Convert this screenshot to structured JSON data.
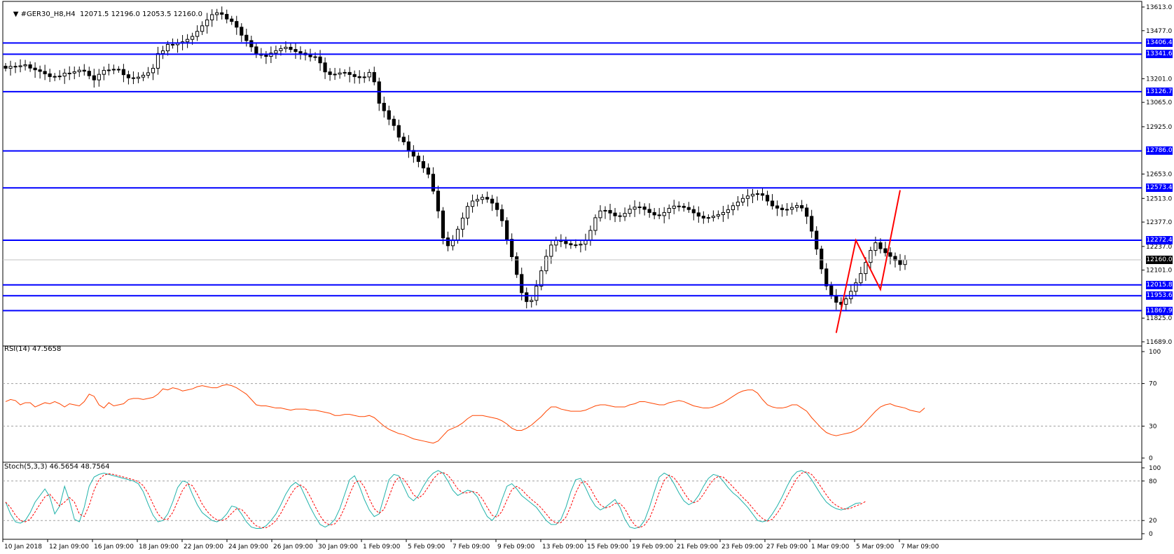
{
  "header": {
    "symbol_label": "#GER30_H8,H4",
    "ohlc_label": "12071.5 12196.0 12053.5 12160.0"
  },
  "colors": {
    "background": "#ffffff",
    "levels": "#0000ff",
    "zigzag": "#ff0000",
    "rsi": "#ff4500",
    "stoch_main": "#20b2aa",
    "stoch_signal": "#ff0000",
    "bull_candle": "#ffffff",
    "bear_candle": "#000000",
    "current_price_tag": "#000000"
  },
  "chart_data": [
    {
      "type": "candlestick",
      "title": "#GER30_H8,H4",
      "ohlc_text": "12071.5 12196.0 12053.5 12160.0",
      "last": {
        "open": 12071.5,
        "high": 12196.0,
        "low": 12053.5,
        "close": 12160.0
      },
      "current_price_label": "12160.0",
      "y_axis_ticks": [
        "13613.0",
        "13477.0",
        "13201.0",
        "13065.0",
        "12925.0",
        "12653.0",
        "12513.0",
        "12377.0",
        "12237.0",
        "12101.0",
        "11825.0",
        "11689.0"
      ],
      "ylim": [
        11689,
        13613
      ],
      "x_axis_ticks": [
        "10 Jan 2018",
        "12 Jan 09:00",
        "16 Jan 09:00",
        "18 Jan 09:00",
        "22 Jan 09:00",
        "24 Jan 09:00",
        "26 Jan 09:00",
        "30 Jan 09:00",
        "1 Feb 09:00",
        "5 Feb 09:00",
        "7 Feb 09:00",
        "9 Feb 09:00",
        "13 Feb 09:00",
        "15 Feb 09:00",
        "19 Feb 09:00",
        "21 Feb 09:00",
        "23 Feb 09:00",
        "27 Feb 09:00",
        "1 Mar 09:00",
        "5 Mar 09:00",
        "7 Mar 09:00"
      ],
      "horizontal_levels": [
        {
          "label": "13406.4",
          "value": 13406.4
        },
        {
          "label": "13341.6",
          "value": 13341.6
        },
        {
          "label": "13126.7",
          "value": 13126.7
        },
        {
          "label": "12786.0",
          "value": 12786.0
        },
        {
          "label": "12573.4",
          "value": 12573.4
        },
        {
          "label": "12272.4",
          "value": 12272.4
        },
        {
          "label": "12015.8",
          "value": 12015.8
        },
        {
          "label": "11953.6",
          "value": 11953.6
        },
        {
          "label": "11867.9",
          "value": 11867.9
        }
      ],
      "closes": [
        13261,
        13272,
        13270,
        13275,
        13281,
        13262,
        13252,
        13243,
        13229,
        13213,
        13214,
        13216,
        13233,
        13233,
        13241,
        13250,
        13244,
        13218,
        13194,
        13226,
        13249,
        13251,
        13255,
        13254,
        13224,
        13206,
        13203,
        13210,
        13221,
        13235,
        13261,
        13346,
        13361,
        13398,
        13396,
        13405,
        13413,
        13427,
        13444,
        13473,
        13505,
        13539,
        13569,
        13580,
        13571,
        13544,
        13530,
        13497,
        13451,
        13420,
        13384,
        13344,
        13336,
        13329,
        13348,
        13362,
        13374,
        13382,
        13369,
        13357,
        13348,
        13338,
        13327,
        13326,
        13292,
        13240,
        13225,
        13227,
        13234,
        13237,
        13225,
        13213,
        13207,
        13211,
        13237,
        13183,
        13060,
        13017,
        12968,
        12932,
        12865,
        12838,
        12789,
        12756,
        12725,
        12688,
        12652,
        12555,
        12441,
        12286,
        12241,
        12275,
        12336,
        12400,
        12467,
        12498,
        12507,
        12519,
        12509,
        12486,
        12449,
        12385,
        12278,
        12178,
        12076,
        11971,
        11920,
        11927,
        12009,
        12097,
        12180,
        12245,
        12271,
        12266,
        12253,
        12246,
        12245,
        12250,
        12273,
        12329,
        12402,
        12441,
        12444,
        12429,
        12413,
        12409,
        12427,
        12451,
        12463,
        12464,
        12450,
        12432,
        12418,
        12414,
        12432,
        12456,
        12469,
        12468,
        12461,
        12449,
        12430,
        12411,
        12400,
        12403,
        12411,
        12420,
        12432,
        12448,
        12471,
        12492,
        12513,
        12527,
        12537,
        12540,
        12531,
        12498,
        12470,
        12457,
        12448,
        12450,
        12461,
        12472,
        12458,
        12410,
        12325,
        12222,
        12108,
        12010,
        11954,
        11916,
        11904,
        11936,
        11979,
        12028,
        12081,
        12145,
        12214,
        12258,
        12224,
        12201,
        12180,
        12157,
        12133,
        12160
      ],
      "zigzag": [
        {
          "bar": 169,
          "price": 11740
        },
        {
          "bar": 173,
          "price": 12272
        },
        {
          "bar": 178,
          "price": 11990
        },
        {
          "bar": 182,
          "price": 12560
        }
      ]
    },
    {
      "type": "line",
      "title": "RSI(14) 47.5658",
      "series": [
        {
          "name": "RSI(14)",
          "values": [
            53,
            55,
            54,
            50,
            52,
            52,
            48,
            50,
            52,
            51,
            53,
            51,
            48,
            51,
            50,
            49,
            53,
            60,
            58,
            50,
            47,
            52,
            49,
            50,
            51,
            55,
            56,
            56,
            55,
            56,
            57,
            60,
            65,
            64,
            66,
            65,
            63,
            64,
            65,
            67,
            68,
            67,
            66,
            66,
            68,
            69,
            68,
            66,
            63,
            60,
            55,
            50,
            49,
            49,
            48,
            47,
            47,
            46,
            45,
            46,
            46,
            46,
            45,
            45,
            44,
            43,
            42,
            40,
            40,
            41,
            41,
            40,
            39,
            39,
            40,
            38,
            34,
            30,
            27,
            25,
            23,
            22,
            20,
            18,
            17,
            16,
            15,
            14,
            16,
            21,
            26,
            28,
            30,
            33,
            37,
            40,
            40,
            40,
            39,
            38,
            37,
            35,
            32,
            28,
            26,
            26,
            28,
            31,
            35,
            39,
            44,
            48,
            48,
            46,
            45,
            44,
            44,
            44,
            45,
            47,
            49,
            50,
            50,
            49,
            48,
            48,
            48,
            50,
            51,
            53,
            53,
            52,
            51,
            50,
            50,
            52,
            53,
            54,
            53,
            51,
            49,
            48,
            47,
            47,
            48,
            50,
            52,
            55,
            58,
            61,
            63,
            64,
            64,
            61,
            55,
            50,
            48,
            47,
            47,
            48,
            50,
            50,
            47,
            44,
            38,
            33,
            28,
            24,
            22,
            21,
            22,
            23,
            24,
            26,
            29,
            34,
            39,
            44,
            48,
            50,
            51,
            49,
            48,
            47,
            45,
            44,
            43,
            47
          ]
        }
      ],
      "ylim": [
        0,
        100
      ],
      "y_axis_ticks": [
        "100",
        "70",
        "30",
        "0"
      ],
      "levels": [
        70,
        30
      ]
    },
    {
      "type": "line",
      "title": "Stoch(5,3,3) 46.5654 48.7564",
      "series": [
        {
          "name": "main",
          "values": [
            48,
            30,
            18,
            16,
            20,
            32,
            48,
            58,
            68,
            56,
            30,
            42,
            72,
            50,
            22,
            18,
            40,
            72,
            86,
            90,
            92,
            90,
            88,
            86,
            84,
            82,
            80,
            76,
            64,
            45,
            28,
            18,
            20,
            30,
            48,
            70,
            80,
            78,
            60,
            44,
            32,
            26,
            20,
            18,
            22,
            30,
            42,
            40,
            30,
            18,
            10,
            8,
            8,
            12,
            20,
            30,
            44,
            60,
            72,
            78,
            72,
            56,
            40,
            26,
            14,
            10,
            14,
            22,
            38,
            60,
            82,
            88,
            72,
            52,
            36,
            26,
            30,
            56,
            82,
            90,
            88,
            72,
            56,
            50,
            58,
            72,
            84,
            92,
            96,
            92,
            80,
            66,
            58,
            62,
            66,
            64,
            56,
            40,
            26,
            20,
            30,
            52,
            72,
            76,
            68,
            58,
            52,
            46,
            40,
            30,
            20,
            14,
            14,
            22,
            40,
            64,
            82,
            84,
            70,
            54,
            42,
            36,
            40,
            46,
            52,
            40,
            22,
            10,
            8,
            10,
            20,
            40,
            64,
            86,
            92,
            88,
            76,
            62,
            50,
            44,
            48,
            58,
            72,
            84,
            90,
            88,
            80,
            70,
            62,
            56,
            48,
            40,
            30,
            20,
            18,
            20,
            30,
            42,
            56,
            72,
            86,
            94,
            96,
            92,
            82,
            70,
            58,
            48,
            42,
            38,
            36,
            38,
            42,
            46,
            47
          ]
        },
        {
          "name": "signal",
          "values": [
            48,
            40,
            28,
            20,
            18,
            22,
            33,
            45,
            56,
            60,
            51,
            42,
            48,
            55,
            48,
            30,
            26,
            43,
            66,
            82,
            89,
            91,
            90,
            88,
            86,
            84,
            82,
            79,
            73,
            61,
            45,
            30,
            22,
            22,
            32,
            49,
            66,
            76,
            73,
            60,
            45,
            34,
            26,
            21,
            20,
            23,
            31,
            38,
            37,
            29,
            19,
            12,
            9,
            9,
            13,
            20,
            31,
            45,
            59,
            70,
            74,
            69,
            56,
            41,
            27,
            17,
            13,
            15,
            24,
            40,
            60,
            77,
            81,
            71,
            53,
            38,
            31,
            37,
            56,
            76,
            86,
            83,
            72,
            59,
            54,
            60,
            71,
            83,
            91,
            93,
            89,
            79,
            68,
            62,
            62,
            64,
            62,
            53,
            40,
            28,
            25,
            34,
            51,
            67,
            72,
            67,
            59,
            52,
            46,
            39,
            30,
            21,
            16,
            17,
            25,
            42,
            62,
            77,
            79,
            69,
            55,
            44,
            39,
            41,
            46,
            46,
            38,
            24,
            13,
            9,
            13,
            23,
            41,
            63,
            81,
            89,
            85,
            75,
            63,
            52,
            47,
            50,
            60,
            72,
            82,
            87,
            86,
            79,
            71,
            63,
            55,
            48,
            39,
            30,
            23,
            19,
            22,
            31,
            43,
            57,
            71,
            84,
            92,
            94,
            90,
            81,
            70,
            59,
            49,
            43,
            39,
            37,
            39,
            42,
            45,
            49
          ]
        }
      ],
      "ylim": [
        0,
        100
      ],
      "y_axis_ticks": [
        "100",
        "80",
        "20",
        "0"
      ],
      "levels": [
        80,
        20
      ]
    }
  ]
}
